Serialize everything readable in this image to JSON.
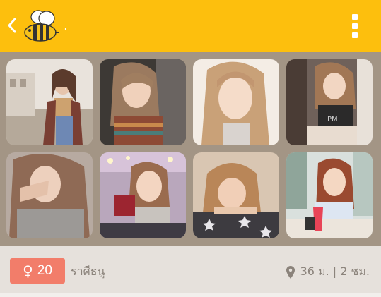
{
  "header": {
    "title": ".",
    "back_icon": "chevron-left-icon",
    "logo_icon": "bee-logo-icon",
    "menu_icon": "overflow-menu-icon",
    "bar_color": "#fdbf0d"
  },
  "photos": [
    {
      "name": "profile-photo-1"
    },
    {
      "name": "profile-photo-2"
    },
    {
      "name": "profile-photo-3"
    },
    {
      "name": "profile-photo-4"
    },
    {
      "name": "profile-photo-5"
    },
    {
      "name": "profile-photo-6"
    },
    {
      "name": "profile-photo-7"
    },
    {
      "name": "profile-photo-8"
    }
  ],
  "profile": {
    "gender_icon": "female-icon",
    "age": "20",
    "zodiac": "ราศีธนู",
    "location_icon": "location-pin-icon",
    "distance": "36 ม. | 2 ชม.",
    "badge_color": "#f27d6a"
  }
}
